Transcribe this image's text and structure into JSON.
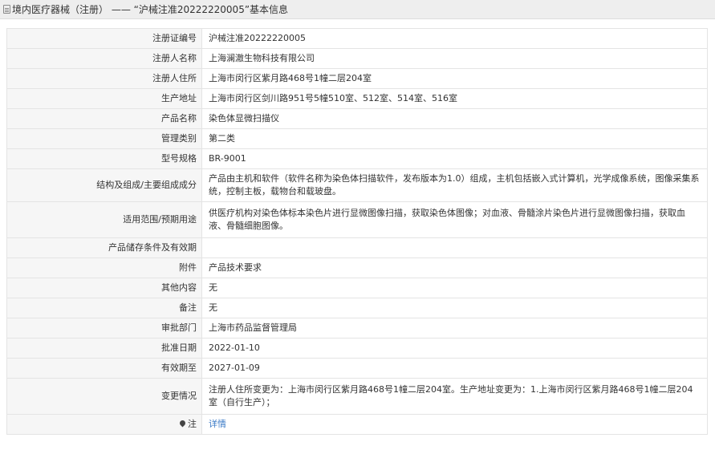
{
  "header": {
    "icon": "document-icon",
    "title": "境内医疗器械（注册） —— “沪械注准20222220005”基本信息"
  },
  "rows": [
    {
      "label": "注册证编号",
      "value": "沪械注准20222220005"
    },
    {
      "label": "注册人名称",
      "value": "上海澜澈生物科技有限公司"
    },
    {
      "label": "注册人住所",
      "value": "上海市闵行区紫月路468号1幢二层204室"
    },
    {
      "label": "生产地址",
      "value": "上海市闵行区剑川路951号5幢510室、512室、514室、516室"
    },
    {
      "label": "产品名称",
      "value": "染色体显微扫描仪"
    },
    {
      "label": "管理类别",
      "value": "第二类"
    },
    {
      "label": "型号规格",
      "value": "BR-9001"
    },
    {
      "label": "结构及组成/主要组成成分",
      "value": "产品由主机和软件（软件名称为染色体扫描软件，发布版本为1.0）组成，主机包括嵌入式计算机，光学成像系统，图像采集系统，控制主板，载物台和载玻盘。"
    },
    {
      "label": "适用范围/预期用途",
      "value": "供医疗机构对染色体标本染色片进行显微图像扫描，获取染色体图像；对血液、骨髓涂片染色片进行显微图像扫描，获取血液、骨髓细胞图像。"
    },
    {
      "label": "产品储存条件及有效期",
      "value": ""
    },
    {
      "label": "附件",
      "value": "产品技术要求"
    },
    {
      "label": "其他内容",
      "value": "无"
    },
    {
      "label": "备注",
      "value": "无"
    },
    {
      "label": "审批部门",
      "value": "上海市药品监督管理局"
    },
    {
      "label": "批准日期",
      "value": "2022-01-10"
    },
    {
      "label": "有效期至",
      "value": "2027-01-09"
    },
    {
      "label": "变更情况",
      "value": "注册人住所变更为：上海市闵行区紫月路468号1幢二层204室。生产地址变更为：1.上海市闵行区紫月路468号1幢二层204室（自行生产）；"
    }
  ],
  "note": {
    "label": "注",
    "icon": "location-pin-icon",
    "link_text": "详情"
  },
  "colors": {
    "label_bg": "#f6f6f6",
    "border": "#e4e4e4",
    "link": "#3a7ac6",
    "header_bg": "#eeeeee"
  }
}
